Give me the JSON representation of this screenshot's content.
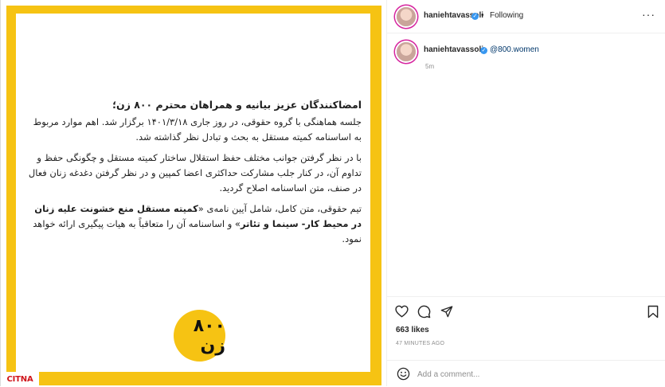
{
  "post": {
    "heading": "امضاکنندگان عزیز بیانیه و همراهان محترم ۸۰۰ زن؛",
    "para1": "جلسه هماهنگی با گروه حقوقی، در روز جاری ۱۴۰۱/۳/۱۸ برگزار شد. اهم موارد مربوط به اساسنامه کمیته مستقل به بحث و تبادل نظر گذاشته شد.",
    "para2": "با در نظر گرفتن جوانب مختلف حفظ استقلال ساختار کمیته مستقل و چگونگی حفظ و تداوم آن، در کنار جلب مشارکت حداکثری اعضا کمپین و در نظر گرفتن دغدغه زنان فعال در صنف، متن اساسنامه اصلاح گردید.",
    "para3_start": "تیم حقوقی، متن کامل، شامل آیین نامه‌ی «",
    "para3_bold": "کمیته مستقل منع خشونت علیه زنان در محیط کار- سینما و تئاتر",
    "para3_end": "» و اساسنامه آن را متعاقباً به هیات پیگیری ارائه خواهد نمود.",
    "logo_text": "۸۰۰ زن"
  },
  "watermark": "CITNA",
  "header": {
    "username": "haniehtavassoli",
    "separator": "•",
    "follow_state": "Following",
    "more": "···"
  },
  "caption": {
    "username": "haniehtavassoli",
    "mention": "@800.women",
    "time": "5m"
  },
  "actions": {
    "icons": [
      "heart-icon",
      "comment-icon",
      "share-icon",
      "bookmark-icon"
    ],
    "likes": "663 likes",
    "timestamp": "47 MINUTES AGO"
  },
  "comment": {
    "placeholder": "Add a comment..."
  },
  "colors": {
    "brand_yellow": "#f6c313",
    "verified_blue": "#3897f0",
    "mention_blue": "#00376b",
    "watermark_red": "#d0151b"
  }
}
